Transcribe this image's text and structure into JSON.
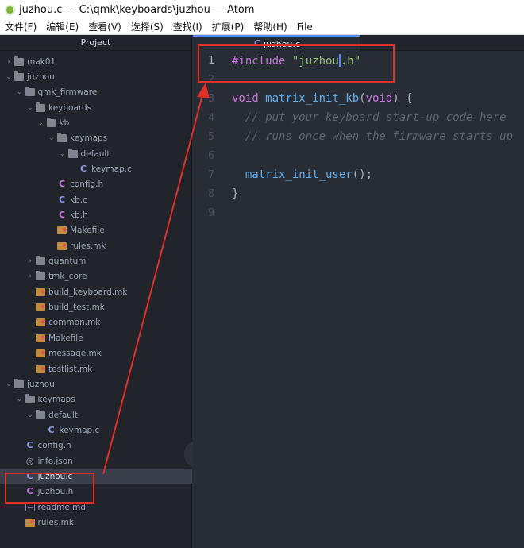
{
  "window": {
    "title": "juzhou.c — C:\\qmk\\keyboards\\juzhou — Atom"
  },
  "menu": [
    "文件(F)",
    "编辑(E)",
    "查看(V)",
    "选择(S)",
    "查找(I)",
    "扩展(P)",
    "帮助(H)",
    "File"
  ],
  "sidebar": {
    "header": "Project"
  },
  "tree": [
    {
      "label": "mak01",
      "kind": "folder",
      "depth": 0,
      "expanded": false
    },
    {
      "label": "juzhou",
      "kind": "folder",
      "depth": 0,
      "expanded": true
    },
    {
      "label": "qmk_firmware",
      "kind": "folder",
      "depth": 1,
      "expanded": true
    },
    {
      "label": "keyboards",
      "kind": "folder",
      "depth": 2,
      "expanded": true
    },
    {
      "label": "kb",
      "kind": "folder",
      "depth": 3,
      "expanded": true
    },
    {
      "label": "keymaps",
      "kind": "folder",
      "depth": 4,
      "expanded": true
    },
    {
      "label": "default",
      "kind": "folder",
      "depth": 5,
      "expanded": true
    },
    {
      "label": "keymap.c",
      "kind": "c",
      "depth": 6
    },
    {
      "label": "config.h",
      "kind": "h",
      "depth": 4
    },
    {
      "label": "kb.c",
      "kind": "c",
      "depth": 4
    },
    {
      "label": "kb.h",
      "kind": "h",
      "depth": 4
    },
    {
      "label": "Makefile",
      "kind": "make",
      "depth": 4
    },
    {
      "label": "rules.mk",
      "kind": "make",
      "depth": 4
    },
    {
      "label": "quantum",
      "kind": "folder",
      "depth": 2,
      "expanded": false
    },
    {
      "label": "tmk_core",
      "kind": "folder",
      "depth": 2,
      "expanded": false
    },
    {
      "label": "build_keyboard.mk",
      "kind": "make",
      "depth": 2
    },
    {
      "label": "build_test.mk",
      "kind": "make",
      "depth": 2
    },
    {
      "label": "common.mk",
      "kind": "make",
      "depth": 2
    },
    {
      "label": "Makefile",
      "kind": "make",
      "depth": 2
    },
    {
      "label": "message.mk",
      "kind": "make",
      "depth": 2
    },
    {
      "label": "testlist.mk",
      "kind": "make",
      "depth": 2
    },
    {
      "label": "juzhou",
      "kind": "folder",
      "depth": 0,
      "expanded": true
    },
    {
      "label": "keymaps",
      "kind": "folder",
      "depth": 1,
      "expanded": true
    },
    {
      "label": "default",
      "kind": "folder",
      "depth": 2,
      "expanded": true
    },
    {
      "label": "keymap.c",
      "kind": "c",
      "depth": 3
    },
    {
      "label": "config.h",
      "kind": "c",
      "depth": 1
    },
    {
      "label": "info.json",
      "kind": "json",
      "depth": 1
    },
    {
      "label": "juzhou.c",
      "kind": "c",
      "depth": 1,
      "selected": true
    },
    {
      "label": "juzhou.h",
      "kind": "h",
      "depth": 1
    },
    {
      "label": "readme.md",
      "kind": "md",
      "depth": 1
    },
    {
      "label": "rules.mk",
      "kind": "make",
      "depth": 1
    }
  ],
  "tab": {
    "label": "juzhou.c"
  },
  "editor": {
    "line_numbers": [
      "1",
      "2",
      "3",
      "4",
      "5",
      "6",
      "7",
      "8",
      "9"
    ],
    "lines": [
      [
        [
          "kw",
          "#include "
        ],
        [
          "str",
          "\"juzhou"
        ],
        [
          "cursor",
          ""
        ],
        [
          "str",
          ".h\""
        ]
      ],
      [],
      [
        [
          "kw",
          "void "
        ],
        [
          "fn",
          "matrix_init_kb"
        ],
        [
          "plain",
          "("
        ],
        [
          "kw",
          "void"
        ],
        [
          "plain",
          ") {"
        ]
      ],
      [
        [
          "plain",
          "  "
        ],
        [
          "cm",
          "// put your keyboard start-up code here"
        ]
      ],
      [
        [
          "plain",
          "  "
        ],
        [
          "cm",
          "// runs once when the firmware starts up"
        ]
      ],
      [],
      [
        [
          "plain",
          "  "
        ],
        [
          "fn",
          "matrix_init_user"
        ],
        [
          "plain",
          "();"
        ]
      ],
      [
        [
          "plain",
          "}"
        ]
      ],
      []
    ]
  },
  "colors": {
    "annotation": "#e0302a",
    "accent": "#528bff"
  }
}
